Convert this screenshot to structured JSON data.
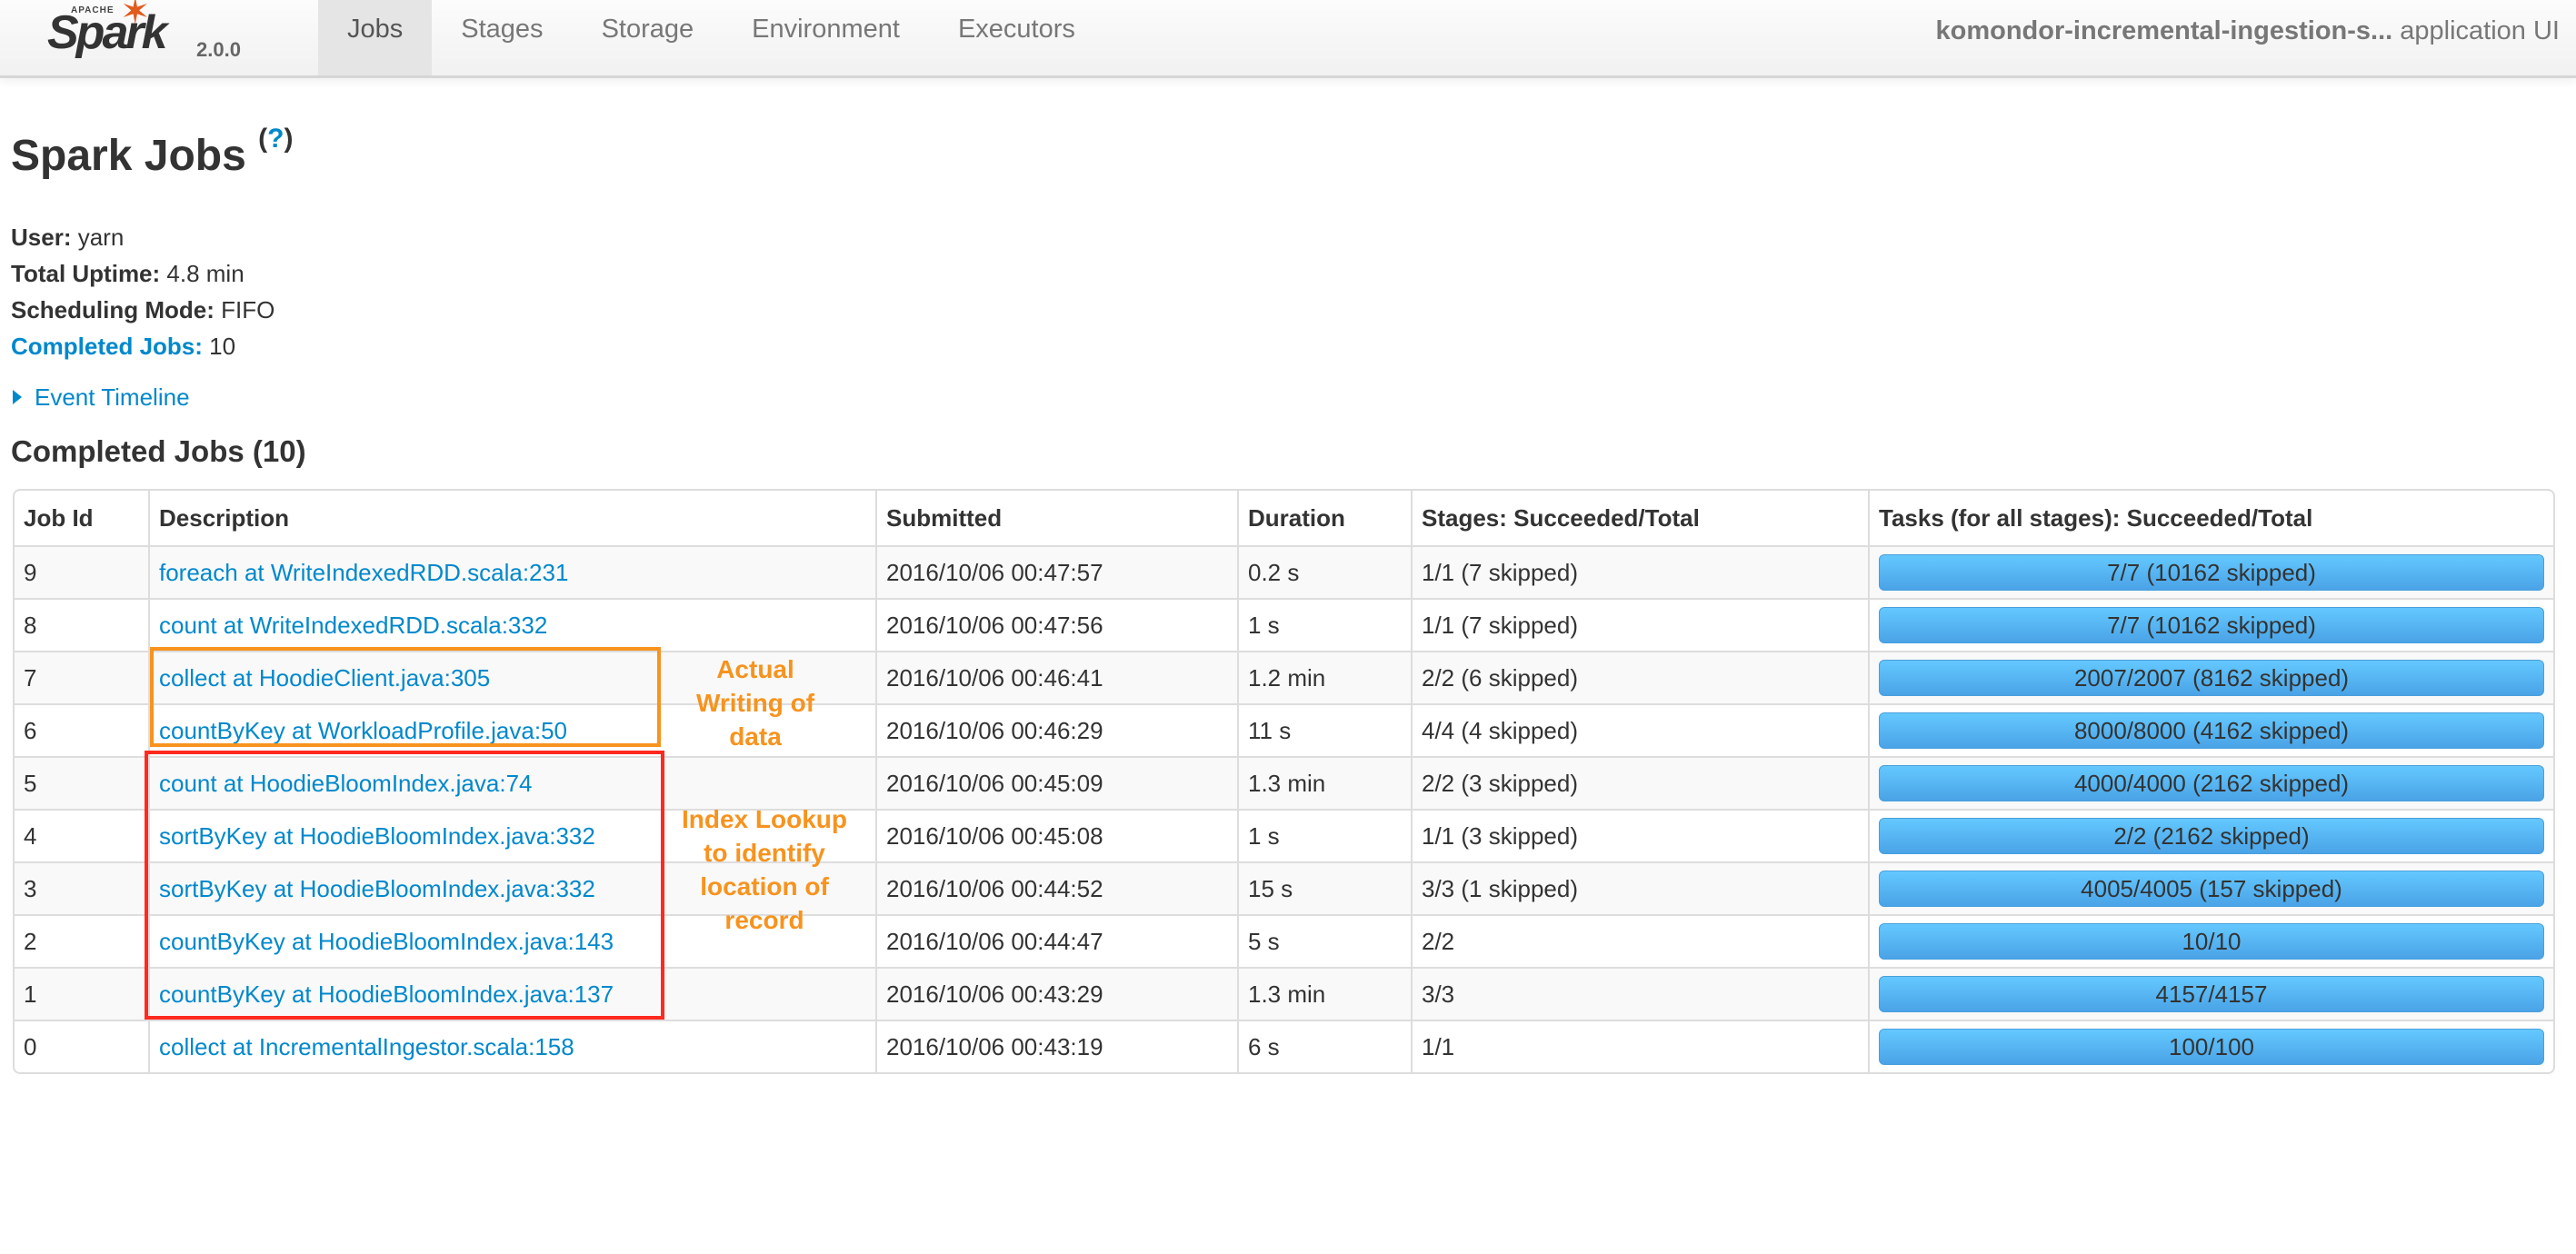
{
  "navbar": {
    "logo_text": "Spark",
    "logo_apache": "APACHE",
    "version": "2.0.0",
    "tabs": [
      {
        "label": "Jobs",
        "active": true
      },
      {
        "label": "Stages",
        "active": false
      },
      {
        "label": "Storage",
        "active": false
      },
      {
        "label": "Environment",
        "active": false
      },
      {
        "label": "Executors",
        "active": false
      }
    ],
    "app_name": "komondor-incremental-ingestion-s...",
    "app_suffix": " application UI"
  },
  "page": {
    "title": "Spark Jobs",
    "help": "?",
    "user_label": "User:",
    "user": " yarn",
    "uptime_label": "Total Uptime:",
    "uptime": " 4.8 min",
    "sched_label": "Scheduling Mode:",
    "sched": " FIFO",
    "completed_label": "Completed Jobs:",
    "completed": " 10",
    "event_timeline": "Event Timeline",
    "section_title": "Completed Jobs (10)"
  },
  "table": {
    "headers": [
      "Job Id",
      "Description",
      "Submitted",
      "Duration",
      "Stages: Succeeded/Total",
      "Tasks (for all stages): Succeeded/Total"
    ],
    "rows": [
      {
        "id": "9",
        "desc": "foreach at WriteIndexedRDD.scala:231",
        "submitted": "2016/10/06 00:47:57",
        "duration": "0.2 s",
        "stages": "1/1 (7 skipped)",
        "tasks": "7/7 (10162 skipped)",
        "progress": 1.0
      },
      {
        "id": "8",
        "desc": "count at WriteIndexedRDD.scala:332",
        "submitted": "2016/10/06 00:47:56",
        "duration": "1 s",
        "stages": "1/1 (7 skipped)",
        "tasks": "7/7 (10162 skipped)",
        "progress": 1.0
      },
      {
        "id": "7",
        "desc": "collect at HoodieClient.java:305",
        "submitted": "2016/10/06 00:46:41",
        "duration": "1.2 min",
        "stages": "2/2 (6 skipped)",
        "tasks": "2007/2007 (8162 skipped)",
        "progress": 1.0
      },
      {
        "id": "6",
        "desc": "countByKey at WorkloadProfile.java:50",
        "submitted": "2016/10/06 00:46:29",
        "duration": "11 s",
        "stages": "4/4 (4 skipped)",
        "tasks": "8000/8000 (4162 skipped)",
        "progress": 1.0
      },
      {
        "id": "5",
        "desc": "count at HoodieBloomIndex.java:74",
        "submitted": "2016/10/06 00:45:09",
        "duration": "1.3 min",
        "stages": "2/2 (3 skipped)",
        "tasks": "4000/4000 (2162 skipped)",
        "progress": 1.0
      },
      {
        "id": "4",
        "desc": "sortByKey at HoodieBloomIndex.java:332",
        "submitted": "2016/10/06 00:45:08",
        "duration": "1 s",
        "stages": "1/1 (3 skipped)",
        "tasks": "2/2 (2162 skipped)",
        "progress": 1.0
      },
      {
        "id": "3",
        "desc": "sortByKey at HoodieBloomIndex.java:332",
        "submitted": "2016/10/06 00:44:52",
        "duration": "15 s",
        "stages": "3/3 (1 skipped)",
        "tasks": "4005/4005 (157 skipped)",
        "progress": 1.0
      },
      {
        "id": "2",
        "desc": "countByKey at HoodieBloomIndex.java:143",
        "submitted": "2016/10/06 00:44:47",
        "duration": "5 s",
        "stages": "2/2",
        "tasks": "10/10",
        "progress": 1.0
      },
      {
        "id": "1",
        "desc": "countByKey at HoodieBloomIndex.java:137",
        "submitted": "2016/10/06 00:43:29",
        "duration": "1.3 min",
        "stages": "3/3",
        "tasks": "4157/4157",
        "progress": 1.0
      },
      {
        "id": "0",
        "desc": "collect at IncrementalIngestor.scala:158",
        "submitted": "2016/10/06 00:43:19",
        "duration": "6 s",
        "stages": "1/1",
        "tasks": "100/100",
        "progress": 1.0
      }
    ]
  },
  "annotations": {
    "writing": {
      "lines": [
        "Actual",
        "Writing of",
        "data"
      ],
      "color": "#f7931e"
    },
    "lookup": {
      "lines": [
        "Index Lookup",
        "to identify",
        "location of",
        "record"
      ],
      "color": "#f7931e",
      "box_color": "#ff2a1f"
    }
  },
  "colors": {
    "link": "#0088cc",
    "progress": "#5bb8f5",
    "accent_spark": "#e25a1c"
  }
}
